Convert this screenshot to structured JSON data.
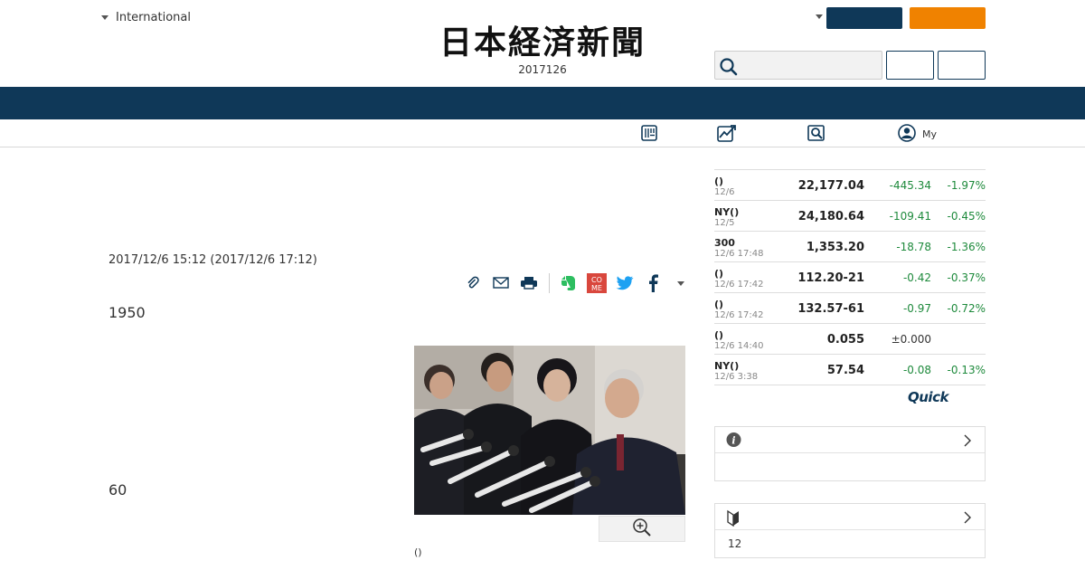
{
  "header": {
    "edition_label": "International",
    "logo_text": "日本経済新聞",
    "date_text": "2017126",
    "search": {
      "placeholder": ""
    }
  },
  "subnav": {
    "my_label": "My"
  },
  "article": {
    "timestamp": "2017/12/6 15:12 (2017/12/6 17:12)",
    "para1": "1950",
    "para2": "60",
    "caption": "()"
  },
  "market": {
    "rows": [
      {
        "name": "()",
        "time": "12/6",
        "value": "22,177.04",
        "change": "-445.34",
        "pct": "-1.97%"
      },
      {
        "name": "NY()",
        "time": "12/5",
        "value": "24,180.64",
        "change": "-109.41",
        "pct": "-0.45%"
      },
      {
        "name": "300",
        "time": "12/6 17:48",
        "value": "1,353.20",
        "change": "-18.78",
        "pct": "-1.36%"
      },
      {
        "name": "()",
        "time": "12/6 17:42",
        "value": "112.20-21",
        "change": "-0.42",
        "pct": "-0.37%"
      },
      {
        "name": "()",
        "time": "12/6 17:42",
        "value": "132.57-61",
        "change": "-0.97",
        "pct": "-0.72%"
      },
      {
        "name": "()",
        "time": "12/6 14:40",
        "value": "0.055",
        "change": "±0.000",
        "pct": ""
      },
      {
        "name": "NY()",
        "time": "12/6 3:38",
        "value": "57.54",
        "change": "-0.08",
        "pct": "-0.13%"
      }
    ],
    "source_logo": "Quick"
  },
  "panels": {
    "info": {
      "body": ""
    },
    "beginner": {
      "body": "12"
    }
  },
  "colors": {
    "brand_navy": "#0f3858",
    "accent_orange": "#f08200",
    "negative_green": "#1e8a3c"
  }
}
